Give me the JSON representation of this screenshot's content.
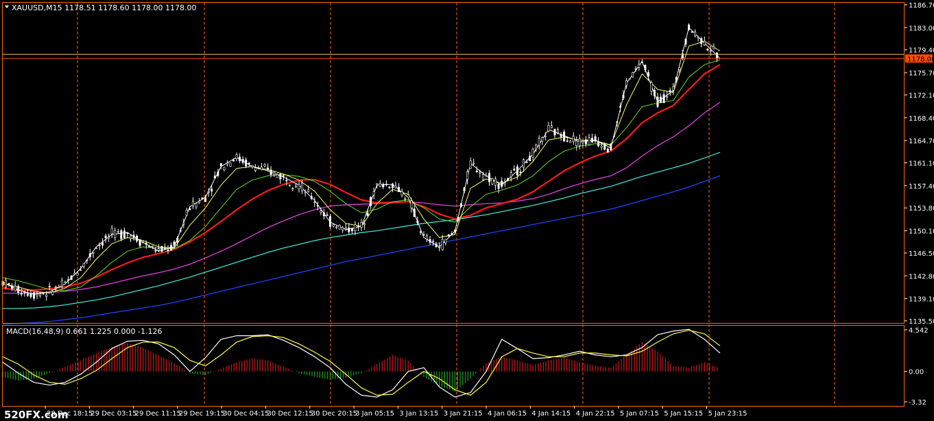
{
  "window": {
    "symbol_header": "XAUUSD,M15  1178.51 1178.60 1178.00 1178.00",
    "watermark": "520FX.com"
  },
  "colors": {
    "background": "#000000",
    "axis_frame": "#ff6a00",
    "grid": "#ff6a00",
    "text": "#ffffff",
    "candle": "#ffffff",
    "price_line": "#ff4a00",
    "ask_line": "#f0c070",
    "ma_fast_white": "#ffffff",
    "ma_yellow": "#ffff66",
    "ma_green": "#66dd22",
    "ma_red": "#ff1a1a",
    "ma_magenta": "#e040e0",
    "ma_cyan": "#40e0d0",
    "ma_blue": "#2040ff",
    "macd_hist_pos": "#b01818",
    "macd_hist_neg": "#1e8a1e",
    "macd_main": "#ffffff",
    "macd_signal": "#ffff44"
  },
  "chart_data": [
    {
      "type": "line",
      "title": "XAUUSD,M15  1178.51 1178.60 1178.00 1178.00",
      "y_ticks": [
        "1186.70",
        "1183.00",
        "1179.40",
        "1175.70",
        "1172.10",
        "1168.40",
        "1164.70",
        "1161.10",
        "1157.40",
        "1153.80",
        "1150.10",
        "1146.50",
        "1142.80",
        "1139.10",
        "1135.50"
      ],
      "ylim": [
        1135.5,
        1186.7
      ],
      "current_price_label": "1178.00",
      "x_ticks": [
        "28 Dec 18:15",
        "29 Dec 03:15",
        "29 Dec 11:15",
        "29 Dec 19:15",
        "30 Dec 04:15",
        "30 Dec 12:15",
        "30 Dec 20:15",
        "3 Jan 05:15",
        "3 Jan 13:15",
        "3 Jan 21:15",
        "4 Jan 06:15",
        "4 Jan 14:15",
        "4 Jan 22:15",
        "5 Jan 07:15",
        "5 Jan 15:15",
        "5 Jan 23:15"
      ],
      "series": [
        {
          "color": "#ffffff",
          "values": [
            1141.8,
            1140.5,
            1139.8,
            1140.2,
            1141.5,
            1144.0,
            1147.5,
            1149.5,
            1149.8,
            1148.2,
            1146.8,
            1147.5,
            1154.0,
            1155.5,
            1160.5,
            1162.0,
            1160.5,
            1159.8,
            1158.8,
            1157.5,
            1155.0,
            1151.5,
            1150.3,
            1150.8,
            1157.5,
            1157.6,
            1155.5,
            1149.0,
            1147.5,
            1150.0,
            1161.0,
            1159.0,
            1157.5,
            1159.8,
            1162.5,
            1166.5,
            1165.5,
            1164.5,
            1164.8,
            1163.5,
            1174.0,
            1177.5,
            1171.0,
            1172.8,
            1183.0,
            1180.5,
            1178.0
          ]
        },
        {
          "color": "#ffff66",
          "values": [
            1141.5,
            1141.0,
            1140.3,
            1140.0,
            1140.8,
            1142.5,
            1145.5,
            1148.0,
            1149.0,
            1148.5,
            1147.5,
            1147.3,
            1151.0,
            1153.8,
            1157.5,
            1160.2,
            1160.5,
            1160.0,
            1159.3,
            1158.3,
            1156.5,
            1153.5,
            1151.3,
            1150.8,
            1154.5,
            1156.8,
            1156.0,
            1152.0,
            1149.0,
            1149.5,
            1157.0,
            1158.5,
            1157.8,
            1158.8,
            1161.3,
            1164.8,
            1165.3,
            1164.8,
            1164.7,
            1164.0,
            1170.5,
            1175.5,
            1173.0,
            1172.5,
            1180.0,
            1180.8,
            1179.2
          ]
        },
        {
          "color": "#66dd22",
          "values": [
            1142.5,
            1142.0,
            1141.3,
            1140.6,
            1140.4,
            1141.0,
            1142.8,
            1145.0,
            1146.8,
            1147.5,
            1147.3,
            1147.2,
            1148.5,
            1150.8,
            1153.8,
            1156.8,
            1158.3,
            1159.0,
            1159.2,
            1158.9,
            1158.1,
            1156.5,
            1154.5,
            1153.0,
            1153.6,
            1154.8,
            1155.1,
            1153.8,
            1152.0,
            1151.5,
            1154.0,
            1156.0,
            1156.7,
            1157.5,
            1159.0,
            1161.3,
            1163.0,
            1163.8,
            1164.2,
            1164.0,
            1166.8,
            1170.2,
            1170.8,
            1171.2,
            1175.0,
            1177.0,
            1177.8
          ]
        },
        {
          "color": "#ff1a1a",
          "values": [
            1140.8,
            1140.5,
            1140.5,
            1140.7,
            1141.0,
            1141.6,
            1142.6,
            1143.8,
            1144.9,
            1145.8,
            1146.4,
            1147.1,
            1148.3,
            1149.8,
            1151.6,
            1153.5,
            1155.2,
            1156.6,
            1157.6,
            1158.3,
            1158.4,
            1157.6,
            1156.3,
            1155.1,
            1154.6,
            1154.7,
            1154.8,
            1154.0,
            1152.8,
            1152.0,
            1152.6,
            1153.8,
            1154.5,
            1155.2,
            1156.4,
            1158.1,
            1159.8,
            1161.1,
            1162.2,
            1163.0,
            1165.0,
            1167.6,
            1169.2,
            1170.4,
            1173.0,
            1175.5,
            1177.0
          ]
        },
        {
          "color": "#e040e0",
          "values": [
            1140.0,
            1140.0,
            1140.0,
            1140.1,
            1140.3,
            1140.6,
            1141.0,
            1141.6,
            1142.2,
            1142.8,
            1143.3,
            1143.9,
            1144.7,
            1145.7,
            1146.8,
            1148.0,
            1149.3,
            1150.6,
            1151.7,
            1152.7,
            1153.5,
            1154.1,
            1154.3,
            1154.4,
            1154.5,
            1154.6,
            1154.8,
            1154.6,
            1154.3,
            1154.1,
            1154.3,
            1154.5,
            1154.6,
            1154.9,
            1155.3,
            1156.0,
            1156.9,
            1157.7,
            1158.4,
            1159.0,
            1160.3,
            1162.2,
            1163.9,
            1165.3,
            1167.1,
            1169.2,
            1170.9
          ]
        },
        {
          "color": "#40e0d0",
          "values": [
            1137.5,
            1137.5,
            1137.6,
            1137.8,
            1138.1,
            1138.5,
            1138.9,
            1139.4,
            1140.0,
            1140.6,
            1141.2,
            1141.9,
            1142.6,
            1143.4,
            1144.2,
            1145.0,
            1145.8,
            1146.6,
            1147.3,
            1147.9,
            1148.5,
            1149.0,
            1149.4,
            1149.8,
            1150.1,
            1150.5,
            1150.9,
            1151.3,
            1151.6,
            1151.9,
            1152.3,
            1152.7,
            1153.2,
            1153.7,
            1154.2,
            1154.8,
            1155.4,
            1156.1,
            1156.7,
            1157.3,
            1158.1,
            1158.9,
            1159.6,
            1160.3,
            1161.0,
            1161.9,
            1162.8
          ]
        },
        {
          "color": "#2040ff",
          "values": [
            1135.0,
            1135.1,
            1135.2,
            1135.4,
            1135.7,
            1136.0,
            1136.4,
            1136.8,
            1137.2,
            1137.6,
            1138.0,
            1138.5,
            1139.1,
            1139.7,
            1140.3,
            1140.9,
            1141.5,
            1142.1,
            1142.7,
            1143.3,
            1143.9,
            1144.5,
            1145.1,
            1145.6,
            1146.1,
            1146.6,
            1147.1,
            1147.6,
            1148.1,
            1148.6,
            1149.1,
            1149.6,
            1150.1,
            1150.6,
            1151.1,
            1151.6,
            1152.1,
            1152.6,
            1153.1,
            1153.6,
            1154.3,
            1155.0,
            1155.7,
            1156.4,
            1157.2,
            1158.1,
            1159.0
          ]
        }
      ]
    },
    {
      "type": "bar",
      "title": "MACD(16,48,9) 0.661 1.225 0.000 -1.126",
      "y_ticks": [
        "4.542",
        "0.00",
        "-3.32"
      ],
      "ylim": [
        -3.32,
        4.542
      ],
      "histogram": [
        -0.6,
        -1.0,
        -0.8,
        -0.2,
        0.5,
        1.2,
        2.0,
        2.7,
        3.1,
        2.6,
        1.8,
        0.9,
        -0.2,
        -0.4,
        0.3,
        1.0,
        1.4,
        1.2,
        0.5,
        -0.2,
        -0.6,
        -0.9,
        -0.7,
        -0.2,
        0.8,
        1.8,
        1.2,
        -0.6,
        -1.6,
        -2.2,
        -0.8,
        0.9,
        1.6,
        1.2,
        0.7,
        1.2,
        1.5,
        1.0,
        0.6,
        0.4,
        1.8,
        3.2,
        2.2,
        0.6,
        0.4,
        1.0,
        0.3
      ],
      "series": [
        {
          "color": "#ffffff",
          "values": [
            1.0,
            -0.2,
            -1.2,
            -1.5,
            -1.2,
            -0.3,
            1.0,
            2.5,
            3.3,
            3.4,
            3.0,
            1.8,
            0.0,
            1.5,
            3.5,
            3.9,
            3.9,
            4.0,
            3.4,
            2.6,
            1.6,
            0.4,
            -1.4,
            -2.6,
            -2.8,
            -2.0,
            0.0,
            0.4,
            -1.7,
            -2.8,
            -2.3,
            0.0,
            3.5,
            2.5,
            1.4,
            1.5,
            1.8,
            2.2,
            1.8,
            1.6,
            1.8,
            2.6,
            4.0,
            4.4,
            4.6,
            3.5,
            2.0
          ]
        },
        {
          "color": "#ffff44",
          "values": [
            1.6,
            0.8,
            -0.4,
            -1.2,
            -1.4,
            -0.8,
            0.1,
            1.4,
            2.6,
            3.2,
            3.2,
            2.6,
            1.2,
            0.6,
            1.8,
            3.2,
            3.8,
            3.9,
            3.7,
            3.0,
            2.1,
            1.1,
            -0.3,
            -1.8,
            -2.6,
            -2.5,
            -1.2,
            0.0,
            -0.8,
            -2.0,
            -2.6,
            -1.2,
            1.6,
            2.5,
            2.0,
            1.6,
            1.6,
            2.0,
            2.0,
            1.8,
            1.7,
            2.2,
            3.2,
            4.1,
            4.5,
            4.1,
            2.8
          ]
        }
      ]
    }
  ]
}
